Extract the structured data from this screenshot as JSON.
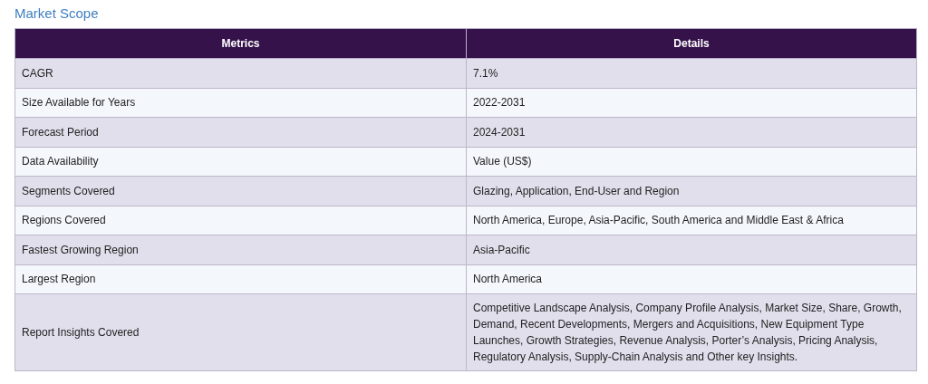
{
  "title": "Market Scope",
  "table": {
    "columns": [
      "Metrics",
      "Details"
    ],
    "rows": [
      [
        "CAGR",
        "7.1%"
      ],
      [
        "Size Available for Years",
        "2022-2031"
      ],
      [
        "Forecast Period",
        "2024-2031"
      ],
      [
        "Data Availability",
        "Value (US$)"
      ],
      [
        "Segments Covered",
        "Glazing, Application, End-User and Region"
      ],
      [
        "Regions Covered",
        "North America, Europe, Asia-Pacific, South America and Middle East & Africa"
      ],
      [
        "Fastest Growing Region",
        "Asia-Pacific"
      ],
      [
        "Largest Region",
        "North America"
      ],
      [
        "Report Insights Covered",
        "Competitive Landscape Analysis, Company Profile Analysis, Market Size, Share, Growth, Demand, Recent Developments, Mergers and Acquisitions, New Equipment Type Launches, Growth Strategies, Revenue Analysis, Porter’s Analysis, Pricing Analysis, Regulatory Analysis, Supply-Chain Analysis and Other key Insights."
      ]
    ]
  }
}
